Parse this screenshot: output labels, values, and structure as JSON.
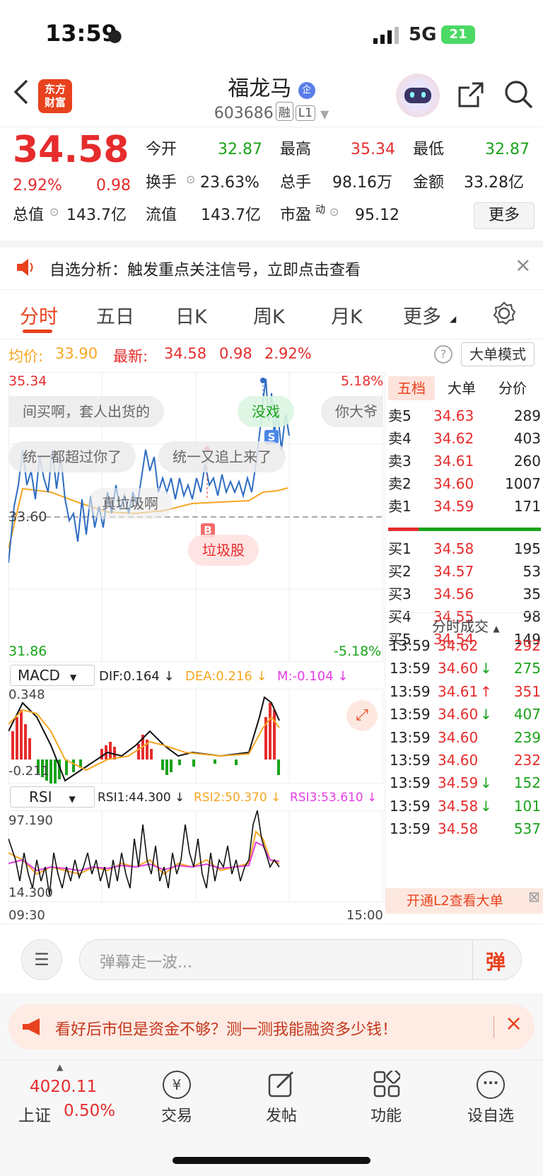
{
  "status": {
    "time": "13:59",
    "network": "5G",
    "battery": "21"
  },
  "header": {
    "logo_line1": "东方",
    "logo_line2": "财富",
    "title": "福龙马",
    "badge": "企",
    "code": "603686",
    "tag1": "融",
    "tag2": "L1"
  },
  "quote": {
    "price": "34.58",
    "pct": "2.92%",
    "chg": "0.98",
    "open_label": "今开",
    "open": "32.87",
    "high_label": "最高",
    "high": "35.34",
    "low_label": "最低",
    "low": "32.87",
    "turnover_label": "换手",
    "turnover": "23.63%",
    "vol_label": "总手",
    "vol": "98.16万",
    "amt_label": "金额",
    "amt": "33.28亿",
    "mcap_label": "总值",
    "mcap": "143.7亿",
    "float_label": "流值",
    "float": "143.7亿",
    "pe_label": "市盈",
    "pe_sup": "动",
    "pe": "95.12",
    "more": "更多"
  },
  "banner": {
    "text": "自选分析：触发重点关注信号，立即点击查看"
  },
  "tabs": [
    "分时",
    "五日",
    "日K",
    "周K",
    "月K",
    "更多"
  ],
  "info": {
    "avg_label": "均价:",
    "avg": "33.90",
    "last_label": "最新:",
    "last": "34.58",
    "chg": "0.98",
    "pct": "2.92%",
    "mode": "大单模式"
  },
  "chart": {
    "y_high": "35.34",
    "y_low": "31.86",
    "pct_high": "5.18%",
    "pct_low": "-5.18%",
    "ref": "33.60",
    "t_start": "09:30",
    "t_end": "15:00",
    "b_marker": "B",
    "s_marker": "S",
    "danmaku": [
      "间买啊，套人出货的",
      "没戏",
      "你大爷",
      "统一都超过你了",
      "统一又追上来了",
      "真垃圾啊",
      "垃圾股"
    ]
  },
  "macd": {
    "label": "MACD",
    "dif": "DIF:0.164 ↓",
    "dea": "DEA:0.216 ↓",
    "m": "M:-0.104 ↓",
    "top": "0.348",
    "bottom": "-0.211"
  },
  "rsi": {
    "label": "RSI",
    "r1": "RSI1:44.300 ↓",
    "r2": "RSI2:50.370 ↓",
    "r3": "RSI3:53.610 ↓",
    "top": "97.190",
    "bottom": "14.300"
  },
  "orderbook": {
    "tabs": [
      "五档",
      "大单",
      "分价"
    ],
    "asks": [
      {
        "l": "卖5",
        "p": "34.63",
        "v": "289"
      },
      {
        "l": "卖4",
        "p": "34.62",
        "v": "403"
      },
      {
        "l": "卖3",
        "p": "34.61",
        "v": "260"
      },
      {
        "l": "卖2",
        "p": "34.60",
        "v": "1007"
      },
      {
        "l": "卖1",
        "p": "34.59",
        "v": "171"
      }
    ],
    "bids": [
      {
        "l": "买1",
        "p": "34.58",
        "v": "195"
      },
      {
        "l": "买2",
        "p": "34.57",
        "v": "53"
      },
      {
        "l": "买3",
        "p": "34.56",
        "v": "35"
      },
      {
        "l": "买4",
        "p": "34.55",
        "v": "98"
      },
      {
        "l": "买5",
        "p": "34.54",
        "v": "149"
      }
    ]
  },
  "ticks": {
    "title": "分时成交",
    "rows": [
      {
        "t": "13:59",
        "p": "34.62",
        "a": "",
        "v": "292",
        "c": "red"
      },
      {
        "t": "13:59",
        "p": "34.60",
        "a": "↓",
        "v": "275",
        "c": "green"
      },
      {
        "t": "13:59",
        "p": "34.61",
        "a": "↑",
        "v": "351",
        "c": "red"
      },
      {
        "t": "13:59",
        "p": "34.60",
        "a": "↓",
        "v": "407",
        "c": "green"
      },
      {
        "t": "13:59",
        "p": "34.60",
        "a": "",
        "v": "239",
        "c": "green"
      },
      {
        "t": "13:59",
        "p": "34.60",
        "a": "",
        "v": "232",
        "c": "red"
      },
      {
        "t": "13:59",
        "p": "34.59",
        "a": "↓",
        "v": "152",
        "c": "green"
      },
      {
        "t": "13:59",
        "p": "34.58",
        "a": "↓",
        "v": "101",
        "c": "green"
      },
      {
        "t": "13:59",
        "p": "34.58",
        "a": "",
        "v": "537",
        "c": "green"
      }
    ],
    "l2": "开通L2查看大单"
  },
  "comment": {
    "placeholder": "弹幕走一波...",
    "btn": "弹"
  },
  "promo": {
    "text": "看好后市但是资金不够？测一测我能融资多少钱！"
  },
  "bottomnav": {
    "index_val": "4020.11",
    "index_name": "上证",
    "index_pct": "0.50%",
    "trade": "交易",
    "post": "发帖",
    "func": "功能",
    "watch": "设自选"
  },
  "colors": {
    "up": "#e62c2c",
    "down": "#1aa31a",
    "avg": "#f5a623",
    "accent": "#e8421e"
  }
}
